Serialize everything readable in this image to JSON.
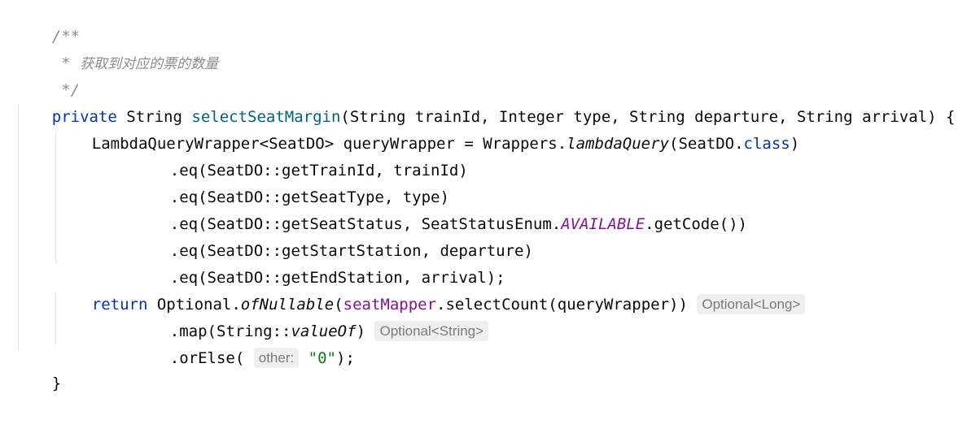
{
  "comment": {
    "open": "/**",
    "star": " * ",
    "text": "获取到对应的票的数量",
    "close": " */"
  },
  "signature": {
    "kw_private": "private",
    "return_type": "String",
    "method_name": "selectSeatMargin",
    "params": "(String trainId, Integer type, String departure, String arrival) {"
  },
  "query_line": {
    "prefix": "LambdaQueryWrapper<SeatDO> queryWrapper = Wrappers.",
    "static_call": "lambdaQuery",
    "arg_open": "(SeatDO.",
    "kw_class": "class",
    "arg_close": ")"
  },
  "eq_lines": [
    ".eq(SeatDO::getTrainId, trainId)",
    ".eq(SeatDO::getSeatType, type)",
    ".eq(SeatDO::getStartStation, departure)",
    ".eq(SeatDO::getEndStation, arrival);"
  ],
  "status_line": {
    "prefix": ".eq(SeatDO::getSeatStatus, SeatStatusEnum.",
    "constant": "AVAILABLE",
    "suffix": ".getCode())"
  },
  "return_line": {
    "kw_return": "return",
    "optional_prefix": " Optional.",
    "static_call": "ofNullable",
    "paren_open": "(",
    "field": "seatMapper",
    "call": ".selectCount(queryWrapper))",
    "hint": "Optional<Long>"
  },
  "map_line": {
    "prefix": ".map(String::",
    "static_ref": "valueOf",
    "suffix": ")",
    "hint": "Optional<String>"
  },
  "orelse_line": {
    "prefix": ".orElse(",
    "param_hint": "other:",
    "string_value": "\"0\"",
    "suffix": ");"
  },
  "closing_brace": "}"
}
